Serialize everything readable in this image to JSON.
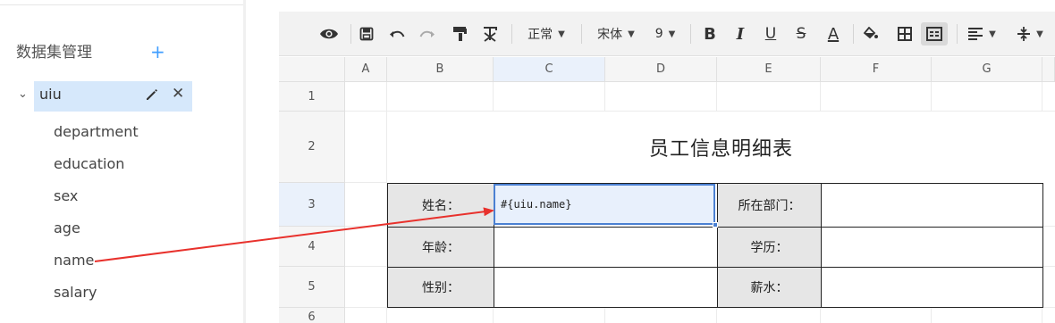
{
  "left_panel": {
    "title": "数据集管理",
    "add_icon": "plus-icon",
    "dataset": {
      "name": "uiu",
      "expanded": true,
      "fields": [
        "department",
        "education",
        "sex",
        "age",
        "name",
        "salary"
      ]
    }
  },
  "toolbar": {
    "font_style": "正常",
    "font_family": "宋体",
    "font_size": "9",
    "buttons": [
      "preview-icon",
      "save-icon",
      "undo-icon",
      "redo-icon",
      "format-painter-icon",
      "clear-format-icon",
      "bold-icon",
      "italic-icon",
      "underline-icon",
      "strikethrough-icon",
      "font-color-icon",
      "fill-color-icon",
      "border-icon",
      "merge-cells-icon",
      "align-icon",
      "valign-icon"
    ],
    "bold": "B",
    "italic": "I",
    "underline": "U",
    "strike": "S",
    "font_color": "A"
  },
  "sheet": {
    "columns": [
      "A",
      "B",
      "C",
      "D",
      "E",
      "F",
      "G"
    ],
    "rows": [
      "1",
      "2",
      "3",
      "4",
      "5",
      "6"
    ],
    "title": "员工信息明细表",
    "labels": {
      "name": "姓名：",
      "department": "所在部门：",
      "age": "年龄：",
      "education": "学历：",
      "sex": "性别：",
      "salary": "薪水："
    },
    "name_cell_value": "#{uiu.name}"
  },
  "colors": {
    "accent": "#409eff",
    "selection": "#4b80d2",
    "arrow": "#e8312c"
  }
}
